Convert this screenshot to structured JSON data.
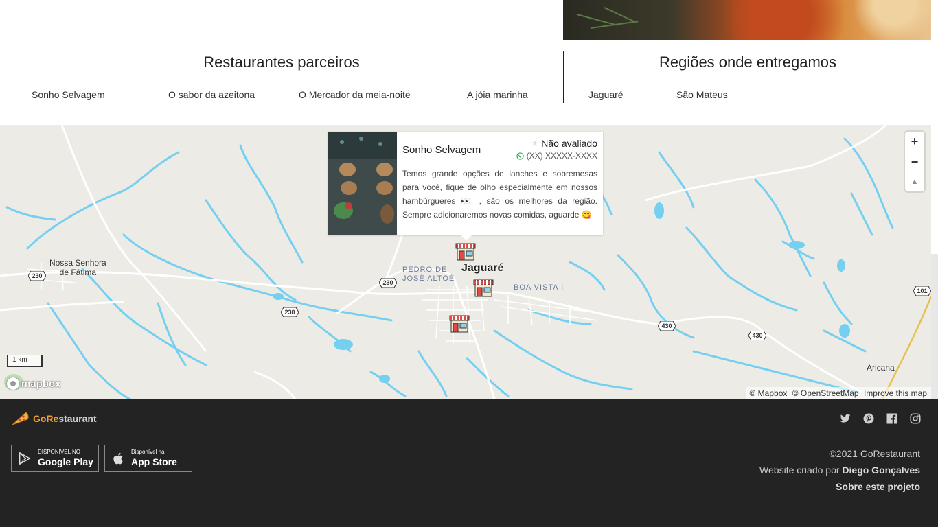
{
  "partners": {
    "title": "Restaurantes parceiros",
    "items": [
      "Sonho Selvagem",
      "O sabor da azeitona",
      "O Mercador da meia-noite",
      "A jóia marinha"
    ]
  },
  "regions": {
    "title": "Regiões onde entregamos",
    "items": [
      "Jaguaré",
      "São Mateus"
    ]
  },
  "map": {
    "places": {
      "nossa_senhora": "Nossa Senhora\nde Fátima",
      "jaguare": "Jaguaré",
      "aricana": "Aricana",
      "pedro": "PEDRO DE\nJOSÉ ALTOÉ",
      "boa_vista": "BOA VISTA I"
    },
    "shields": [
      "230",
      "230",
      "230",
      "430",
      "430",
      "101"
    ],
    "zoom": {
      "in": "+",
      "out": "−",
      "compass": "▲"
    },
    "scale": "1 km",
    "logo": "mapbox",
    "attribution": [
      "© Mapbox",
      "© OpenStreetMap",
      "Improve this map"
    ],
    "water_color": "#75cff0",
    "land_color": "#ecebe6"
  },
  "popup": {
    "name": "Sonho Selvagem",
    "rating": "Não avaliado",
    "phone": "(XX) XXXXX-XXXX",
    "description": "Temos grande opções de lanches e sobremesas para você, fique de olho especialmente em nossos hambúrgueres 👀 , são os melhores da região. Sempre adicionaremos novas comidas, aguarde 😋"
  },
  "footer": {
    "brand_prefix": "GoRe",
    "brand_suffix": "staurant",
    "google": {
      "small": "DISPONÍVEL NO",
      "big": "Google Play"
    },
    "apple": {
      "small": "Disponível na",
      "big": "App Store"
    },
    "copyright": "©2021 GoRestaurant",
    "made_by_prefix": "Website criado por",
    "made_by_name": "Diego Gonçalves",
    "about": "Sobre este projeto",
    "accent_color": "#f0a030"
  }
}
